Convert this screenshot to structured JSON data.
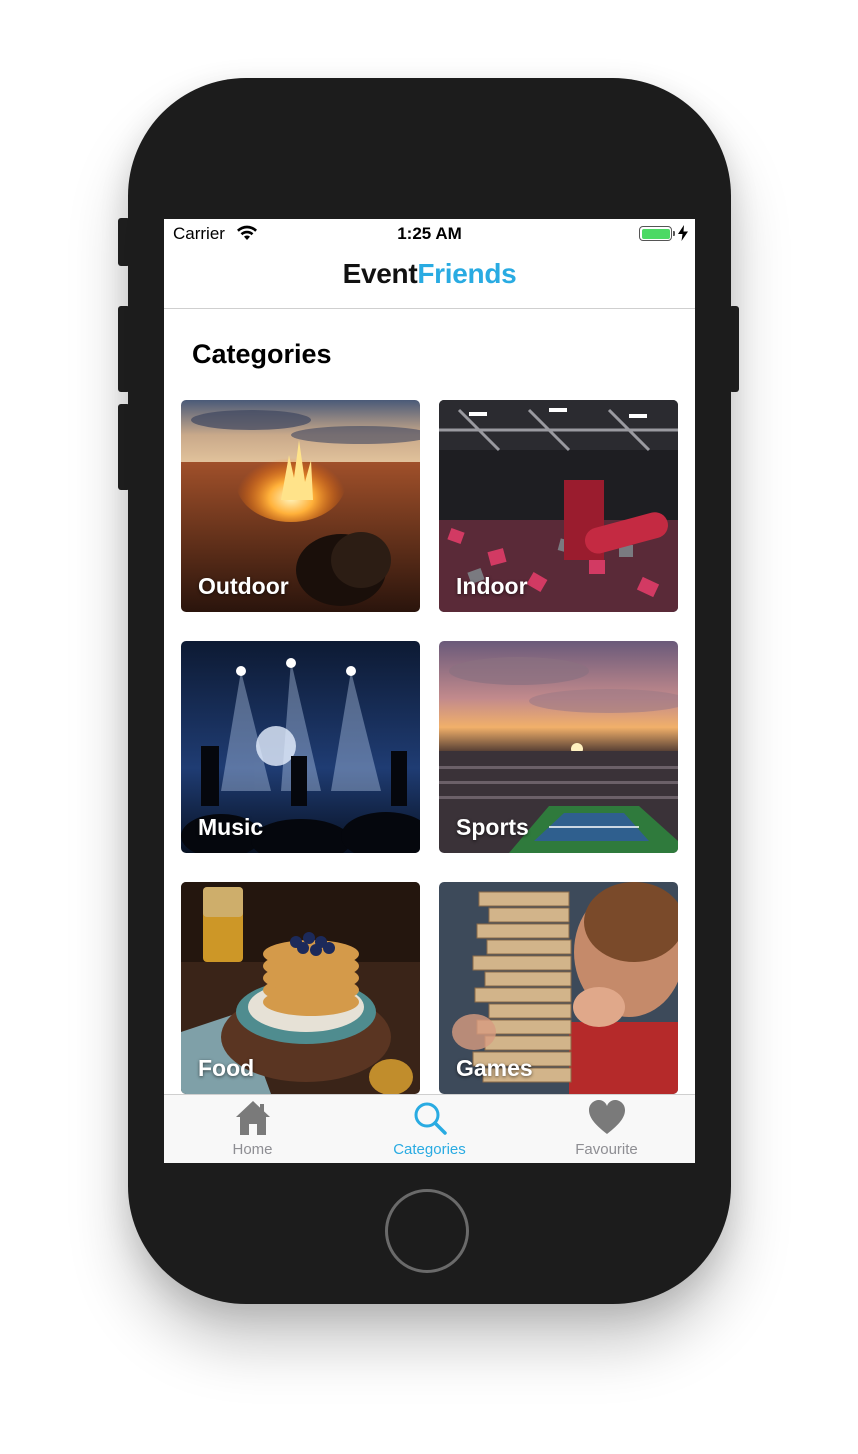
{
  "status_bar": {
    "carrier": "Carrier",
    "time": "1:25 AM",
    "battery_color": "#4cd964"
  },
  "nav": {
    "brand_part1": "Event",
    "brand_part2": "Friends",
    "brand_accent": "#29abe2"
  },
  "page": {
    "title": "Categories"
  },
  "categories": [
    {
      "label": "Outdoor",
      "image": "campfire on beach at sunset"
    },
    {
      "label": "Indoor",
      "image": "trampoline park with foam pit"
    },
    {
      "label": "Music",
      "image": "concert stage with blue lights"
    },
    {
      "label": "Sports",
      "image": "tennis stadium at sunset"
    },
    {
      "label": "Food",
      "image": "stack of pancakes with blueberries"
    },
    {
      "label": "Games",
      "image": "child playing jenga"
    }
  ],
  "tabs": [
    {
      "label": "Home",
      "icon": "home-icon",
      "active": false
    },
    {
      "label": "Categories",
      "icon": "search-icon",
      "active": true
    },
    {
      "label": "Favourite",
      "icon": "heart-icon",
      "active": false
    }
  ]
}
